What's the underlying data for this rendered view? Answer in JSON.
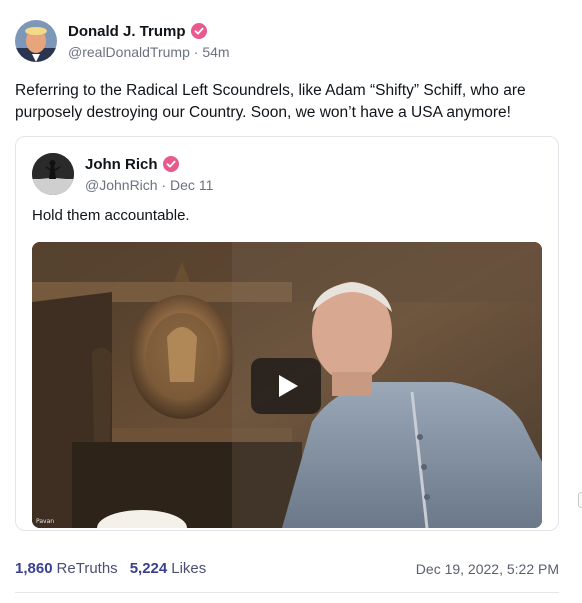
{
  "post": {
    "author": {
      "display_name": "Donald J. Trump",
      "handle": "@realDonaldTrump",
      "separator": "·",
      "time_ago": "54m",
      "verified_icon": "verified-badge-icon"
    },
    "text": "Referring to the Radical Left Scoundrels, like Adam “Shifty” Schiff, who are purposely destroying our Country. Soon, we won’t have a USA anymore!",
    "quote": {
      "author": {
        "display_name": "John Rich",
        "handle": "@JohnRich",
        "separator": "·",
        "date": "Dec 11",
        "verified_icon": "verified-badge-icon"
      },
      "text": "Hold them accountable.",
      "video": {
        "play_icon": "play-icon",
        "watermark": "Pavan"
      }
    },
    "stats": {
      "retruths_count": "1,860",
      "retruths_label": "ReTruths",
      "likes_count": "5,224",
      "likes_label": "Likes",
      "timestamp": "Dec 19, 2022, 5:22 PM"
    }
  },
  "colors": {
    "verified": "#e85a8e",
    "accent": "#3a3f91",
    "muted": "#6a7280",
    "border": "#e3e5ea"
  }
}
